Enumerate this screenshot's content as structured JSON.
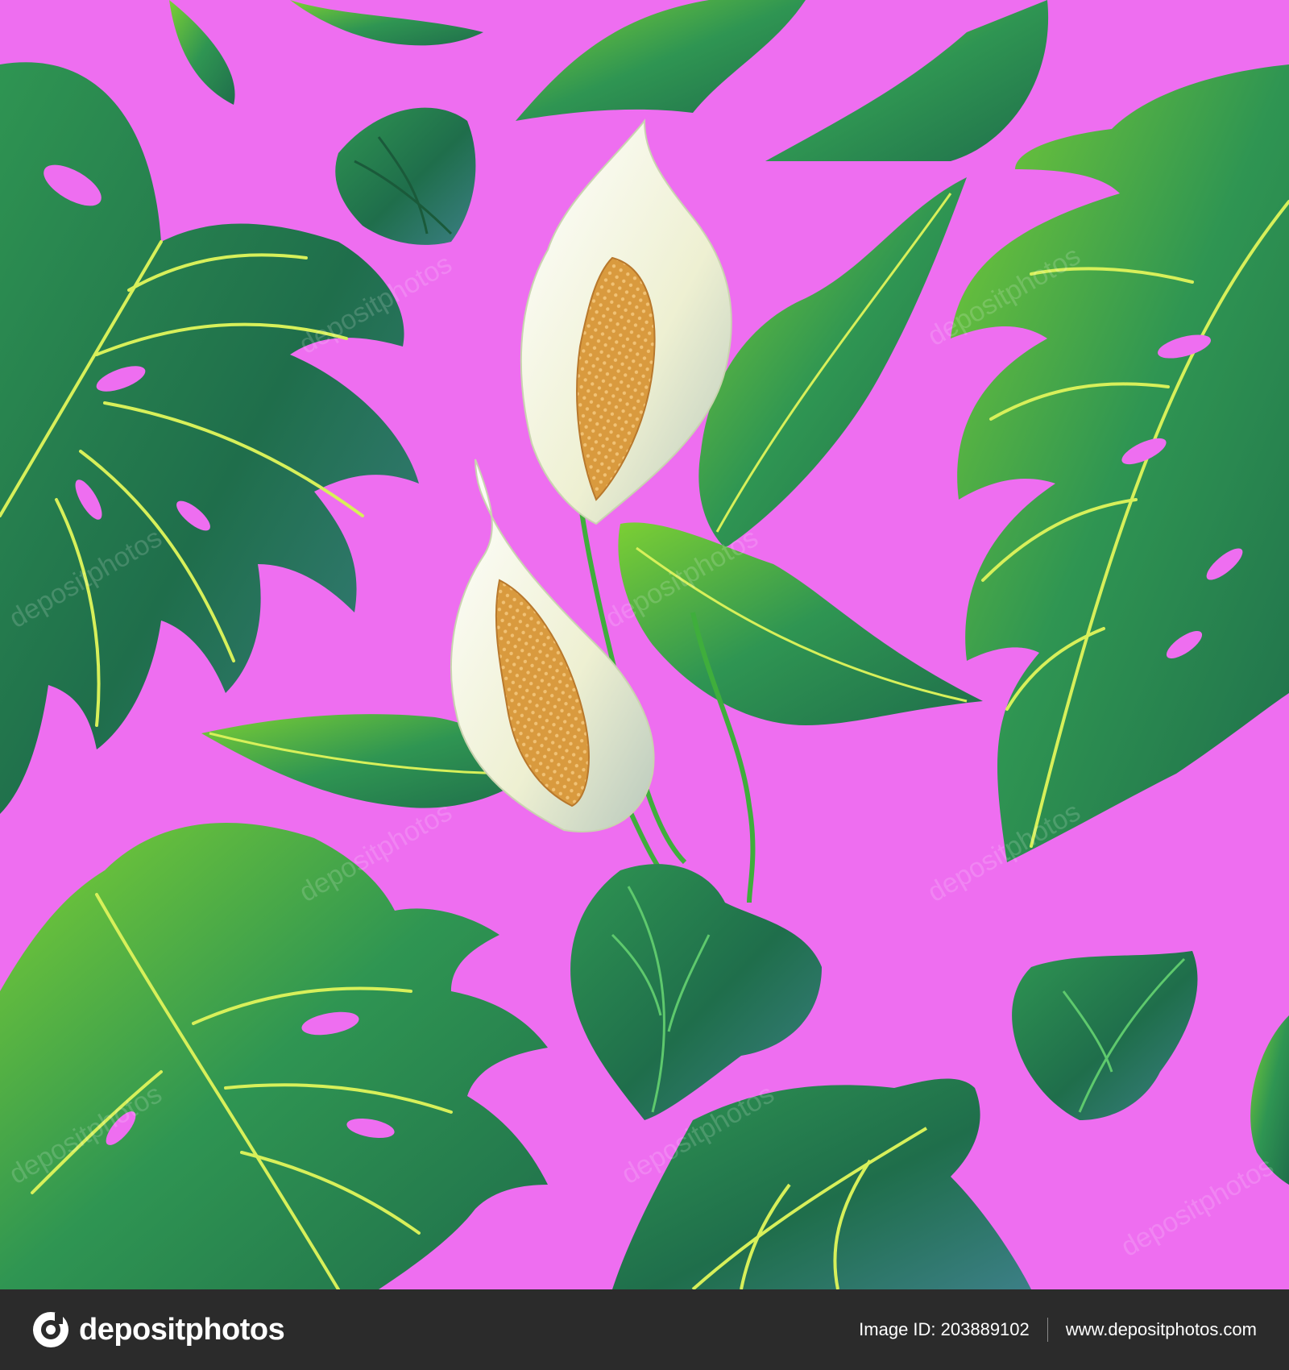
{
  "colors": {
    "background": "#ee6ef0",
    "leaf_dark": "#1f6e4b",
    "leaf_mid": "#2f9552",
    "leaf_light": "#7ccf34",
    "vein": "#d7f05a",
    "spathe": "#f4f3e4",
    "spadix": "#d99a3e",
    "footer": "#2b2b2b"
  },
  "watermark": {
    "text": "depositphotos",
    "repeat_hint": "diagonal-tiles"
  },
  "footer": {
    "logo_icon": "depositphotos-logo-icon",
    "brand": "depositphotos",
    "image_id_label": "Image ID: 203889102",
    "site": "www.depositphotos.com"
  },
  "illustration": {
    "subject_icons": [
      "monstera-leaf-icon",
      "peace-lily-flower-icon",
      "heart-shaped-leaf-icon",
      "lance-leaf-icon"
    ]
  }
}
